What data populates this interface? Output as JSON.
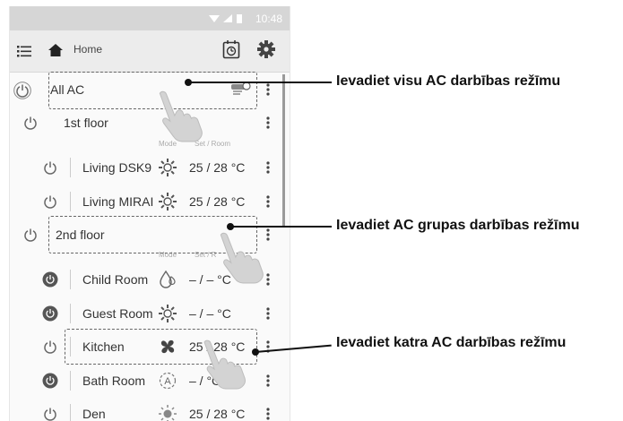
{
  "status_bar": {
    "time": "10:48"
  },
  "header": {
    "title": "Home"
  },
  "list": {
    "all_ac": {
      "label": "All AC"
    },
    "floor1": {
      "label": "1st floor",
      "mode_header": "Mode",
      "set_header": "Set / Room"
    },
    "floor1_items": [
      {
        "name": "Living DSK9",
        "mode_icon": "sun-gear-icon",
        "temp": "25 / 28 °C",
        "power": "off"
      },
      {
        "name": "Living MIRAI",
        "mode_icon": "sun-gear-icon",
        "temp": "25 / 28 °C",
        "power": "off"
      }
    ],
    "floor2": {
      "label": "2nd floor",
      "mode_header": "Mode",
      "set_header": "Set / R"
    },
    "floor2_items": [
      {
        "name": "Child Room",
        "mode_icon": "droplet-icon",
        "temp": "– / –   °C",
        "power": "on"
      },
      {
        "name": "Guest Room",
        "mode_icon": "sun-gear-icon",
        "temp": "– / –   °C",
        "power": "on"
      },
      {
        "name": "Kitchen",
        "mode_icon": "fan-icon",
        "temp": "25 / 28 °C",
        "power": "off"
      },
      {
        "name": "Bath Room",
        "mode_icon": "auto-mode-icon",
        "temp": "– /    °C",
        "power": "on"
      },
      {
        "name": "Den",
        "mode_icon": "sun-icon",
        "temp": "25 / 28 °C",
        "power": "off"
      }
    ]
  },
  "callouts": [
    "Ievadiet visu AC darbības režīmu",
    "Ievadiet AC grupas darbības režīmu",
    "Ievadiet katra AC darbības režīmu"
  ]
}
